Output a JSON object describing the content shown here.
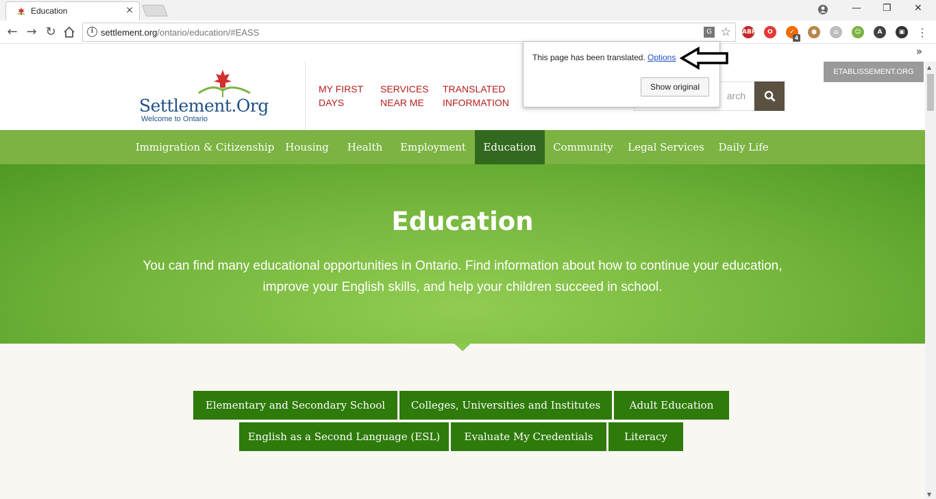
{
  "browser": {
    "tab_title": "Education",
    "tab_close": "×",
    "url_host": "settlement.org",
    "url_path": "/ontario/education/#EASS",
    "window_controls": {
      "minimize": "—",
      "restore": "❐",
      "close": "✕"
    },
    "extensions": [
      {
        "label": "ABP",
        "color": "#c62828"
      },
      {
        "label": "O",
        "color": "#e53935"
      },
      {
        "label": "✓",
        "color": "#ef6c00"
      },
      {
        "label": "●",
        "color": "#b8864b"
      },
      {
        "label": "⌂",
        "color": "#bdbdbd"
      },
      {
        "label": "☺",
        "color": "#7cb342"
      },
      {
        "label": "A",
        "color": "#424242"
      },
      {
        "label": "▣",
        "color": "#333333"
      }
    ],
    "ext_badge": "4",
    "bookmarks_overflow": "»"
  },
  "translate_popup": {
    "message": "This page has been translated.",
    "options_link": "Options",
    "show_original": "Show original"
  },
  "header": {
    "logo_name": "Settlement.Org",
    "logo_tagline": "Welcome to Ontario",
    "links": [
      {
        "line1": "MY FIRST",
        "line2": "DAYS"
      },
      {
        "line1": "SERVICES",
        "line2": "NEAR ME"
      },
      {
        "line1": "TRANSLATED",
        "line2": "INFORMATION"
      }
    ],
    "search_placeholder": "arch",
    "language_tab": "ETABLISSEMENT.ORG"
  },
  "nav": {
    "items": [
      "Immigration & Citizenship",
      "Housing",
      "Health",
      "Employment",
      "Education",
      "Community",
      "Legal Services",
      "Daily Life"
    ],
    "active": "Education"
  },
  "hero": {
    "title": "Education",
    "description": "You can find many educational opportunities in Ontario. Find information about how to continue your education, improve your English skills, and help your children succeed in school."
  },
  "subsections": [
    "Elementary and Secondary School",
    "Colleges, Universities and Institutes",
    "Adult Education",
    "English as a Second Language (ESL)",
    "Evaluate My Credentials",
    "Literacy"
  ],
  "colors": {
    "nav_green": "#7cb342",
    "active_green": "#33691e",
    "button_green": "#2e7a0a",
    "header_link_red": "#b71c1c",
    "logo_blue": "#1d4f86"
  }
}
